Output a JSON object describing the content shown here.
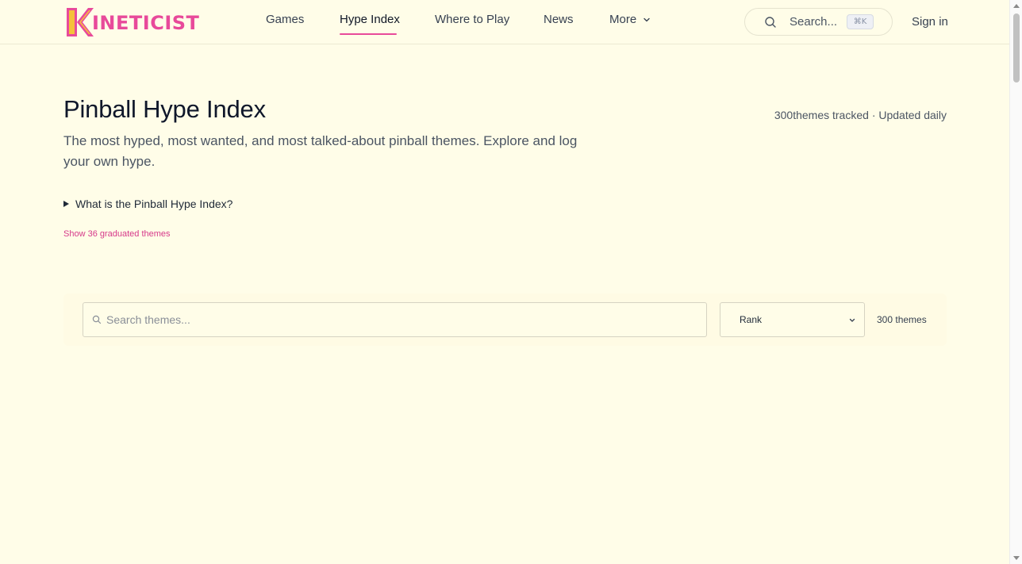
{
  "brand": {
    "name": "INETICIST",
    "accent": "#e84a9a",
    "mark_color": "#f5c13a"
  },
  "nav": {
    "items": [
      {
        "label": "Games"
      },
      {
        "label": "Hype Index",
        "active": true
      },
      {
        "label": "Where to Play"
      },
      {
        "label": "News"
      },
      {
        "label": "More"
      }
    ]
  },
  "search": {
    "placeholder": "Search...",
    "shortcut": "⌘K"
  },
  "auth": {
    "signin_label": "Sign in"
  },
  "page": {
    "title": "Pinball Hype Index",
    "meta_count": "300",
    "meta_rest": "themes tracked",
    "meta_sep": "·",
    "meta_updated": "Updated daily",
    "subtitle": "The most hyped, most wanted, and most talked-about pinball themes. Explore and log your own hype.",
    "details_summary": "What is the Pinball Hype Index?",
    "graduated_link": "Show 36 graduated themes"
  },
  "filters": {
    "search_placeholder": "Search themes...",
    "sort_value": "Rank",
    "count_label": "300 themes"
  }
}
